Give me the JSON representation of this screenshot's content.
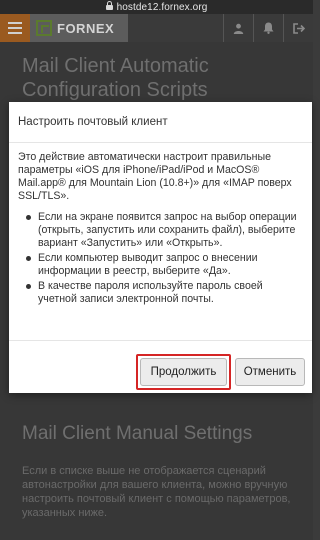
{
  "browser": {
    "url": "hostde12.fornex.org"
  },
  "header": {
    "logo_text": "FORNEX",
    "icons": [
      "user-icon",
      "bell-icon",
      "logout-icon"
    ]
  },
  "page": {
    "title": "Mail Client Automatic Configuration Scripts",
    "manual_heading": "Mail Client Manual Settings",
    "manual_text": "Если в списке выше не отображается сценарий автонастройки для вашего клиента, можно вручную настроить почтовый клиент с помощью параметров, указанных ниже."
  },
  "modal": {
    "title": "Настроить почтовый клиент",
    "intro": "Это действие автоматически настроит правильные параметры «iOS для iPhone/iPad/iPod и MacOS® Mail.app® для Mountain Lion (10.8+)» для «IMAP поверх SSL/TLS».",
    "bullets": [
      "Если на экране появится запрос на выбор операции (открыть, запустить или сохранить файл), выберите вариант «Запустить» или «Открыть».",
      "Если компьютер выводит запрос о внесении информации в реестр, выберите «Да».",
      "В качестве пароля используйте пароль своей учетной записи электронной почты."
    ],
    "continue_label": "Продолжить",
    "cancel_label": "Отменить"
  },
  "colors": {
    "highlight": "#d52525",
    "brand_green": "#5b7a2e",
    "menu_orange": "#f07a20"
  }
}
